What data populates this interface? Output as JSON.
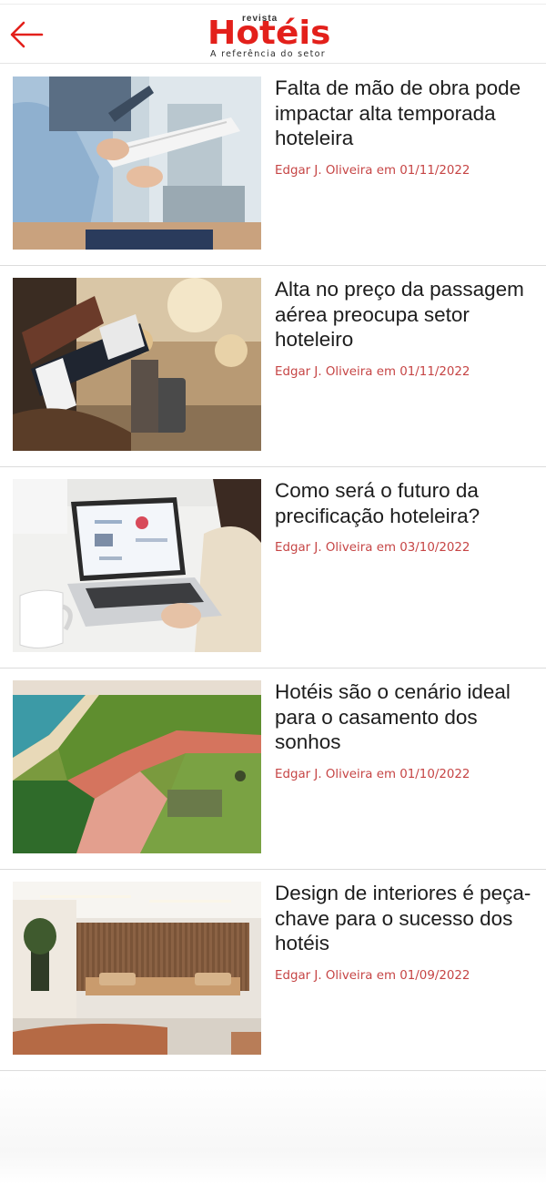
{
  "header": {
    "back_icon": "arrow-left-icon",
    "logo_small": "revista",
    "logo_main": "Hotéis",
    "logo_tagline": "A referência do setor",
    "accent_color": "#e3201b"
  },
  "articles": [
    {
      "title": "Falta de mão de obra pode impactar alta temporada hoteleira",
      "byline": "Edgar J. Oliveira em 01/11/2022",
      "image": "person-holding-clipboard-photo"
    },
    {
      "title": "Alta no preço da passagem aérea preocupa setor hoteleiro",
      "byline": "Edgar J. Oliveira em 01/11/2022",
      "image": "traveler-with-tickets-airport-photo"
    },
    {
      "title": "Como será o futuro da precificação hoteleira?",
      "byline": "Edgar J. Oliveira em 03/10/2022",
      "image": "laptop-with-charts-photo"
    },
    {
      "title": "Hotéis são o cenário ideal para o casamento dos sonhos",
      "byline": "Edgar J. Oliveira em 01/10/2022",
      "image": "coastal-cliffs-resort-photo"
    },
    {
      "title": "Design de interiores é peça-chave para o sucesso dos hotéis",
      "byline": "Edgar J. Oliveira em 01/09/2022",
      "image": "hotel-lobby-interior-photo"
    }
  ],
  "byline_color": "#c64545"
}
